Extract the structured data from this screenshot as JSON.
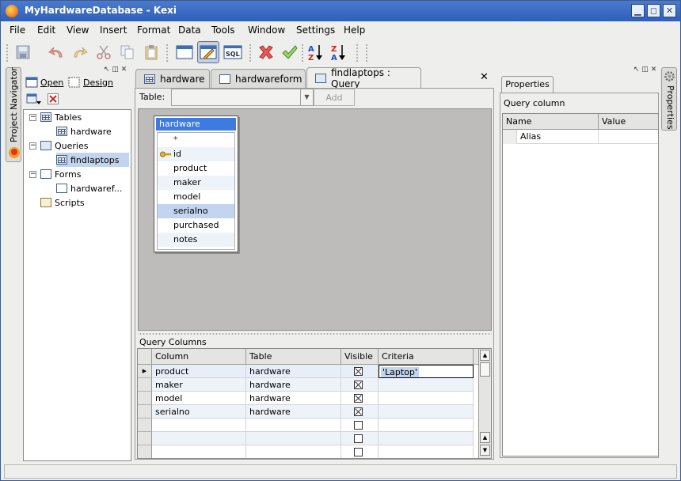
{
  "window": {
    "title": "MyHardwareDatabase - Kexi",
    "min_glyph": "▁",
    "max_glyph": "◻",
    "close_glyph": "✕"
  },
  "menubar": {
    "items": [
      "File",
      "Edit",
      "View",
      "Insert",
      "Format",
      "Data",
      "Tools",
      "Window",
      "Settings",
      "Help"
    ]
  },
  "toolbar": {
    "icons": [
      "save-icon",
      "undo-icon",
      "redo-icon",
      "cut-icon",
      "copy-icon",
      "paste-icon",
      "data-view-icon",
      "design-view-icon",
      "sql-view-icon",
      "cancel-icon",
      "apply-icon",
      "sort-ascending-icon",
      "sort-descending-icon"
    ],
    "sql_label": "SQL"
  },
  "left_strip": {
    "tab_label": "Project Navigator"
  },
  "navigator": {
    "open_label": "Open",
    "design_label": "Design",
    "tree": [
      {
        "label": "Tables",
        "type": "group",
        "expander": "⊟"
      },
      {
        "label": "hardware",
        "type": "table"
      },
      {
        "label": "Queries",
        "type": "group",
        "expander": "⊟"
      },
      {
        "label": "findlaptops",
        "type": "query",
        "selected": true
      },
      {
        "label": "Forms",
        "type": "group",
        "expander": "⊟"
      },
      {
        "label": "hardwaref...",
        "type": "form"
      },
      {
        "label": "Scripts",
        "type": "group"
      }
    ]
  },
  "tabs": {
    "items": [
      {
        "label": "hardware",
        "icon": "table-icon"
      },
      {
        "label": "hardwareform",
        "icon": "form-icon"
      },
      {
        "label": "findlaptops : Query",
        "icon": "query-icon",
        "active": true
      }
    ],
    "close_glyph": "✕"
  },
  "query_designer": {
    "table_label": "Table:",
    "table_value": "",
    "add_label": "Add",
    "table_box": {
      "name": "hardware",
      "fields": [
        "*",
        "id",
        "product",
        "maker",
        "model",
        "serialno",
        "purchased",
        "notes"
      ],
      "primary_key": "id",
      "selected_field": "serialno"
    },
    "columns_label": "Query Columns",
    "grid": {
      "headers": [
        "Column",
        "Table",
        "Visible",
        "Criteria"
      ],
      "rows": [
        {
          "column": "product",
          "table": "hardware",
          "visible": true,
          "criteria": "'Laptop'",
          "current": true
        },
        {
          "column": "maker",
          "table": "hardware",
          "visible": true,
          "criteria": ""
        },
        {
          "column": "model",
          "table": "hardware",
          "visible": true,
          "criteria": ""
        },
        {
          "column": "serialno",
          "table": "hardware",
          "visible": true,
          "criteria": ""
        },
        {
          "column": "",
          "table": "",
          "visible": false,
          "criteria": ""
        },
        {
          "column": "",
          "table": "",
          "visible": false,
          "criteria": ""
        },
        {
          "column": "",
          "table": "",
          "visible": false,
          "criteria": ""
        }
      ]
    }
  },
  "properties": {
    "tab_label": "Properties",
    "section_label": "Query column",
    "headers": [
      "Name",
      "Value"
    ],
    "rows": [
      {
        "name": "Alias",
        "value": ""
      }
    ],
    "side_tab_label": "Properties"
  },
  "statusbar": {
    "text": ""
  }
}
